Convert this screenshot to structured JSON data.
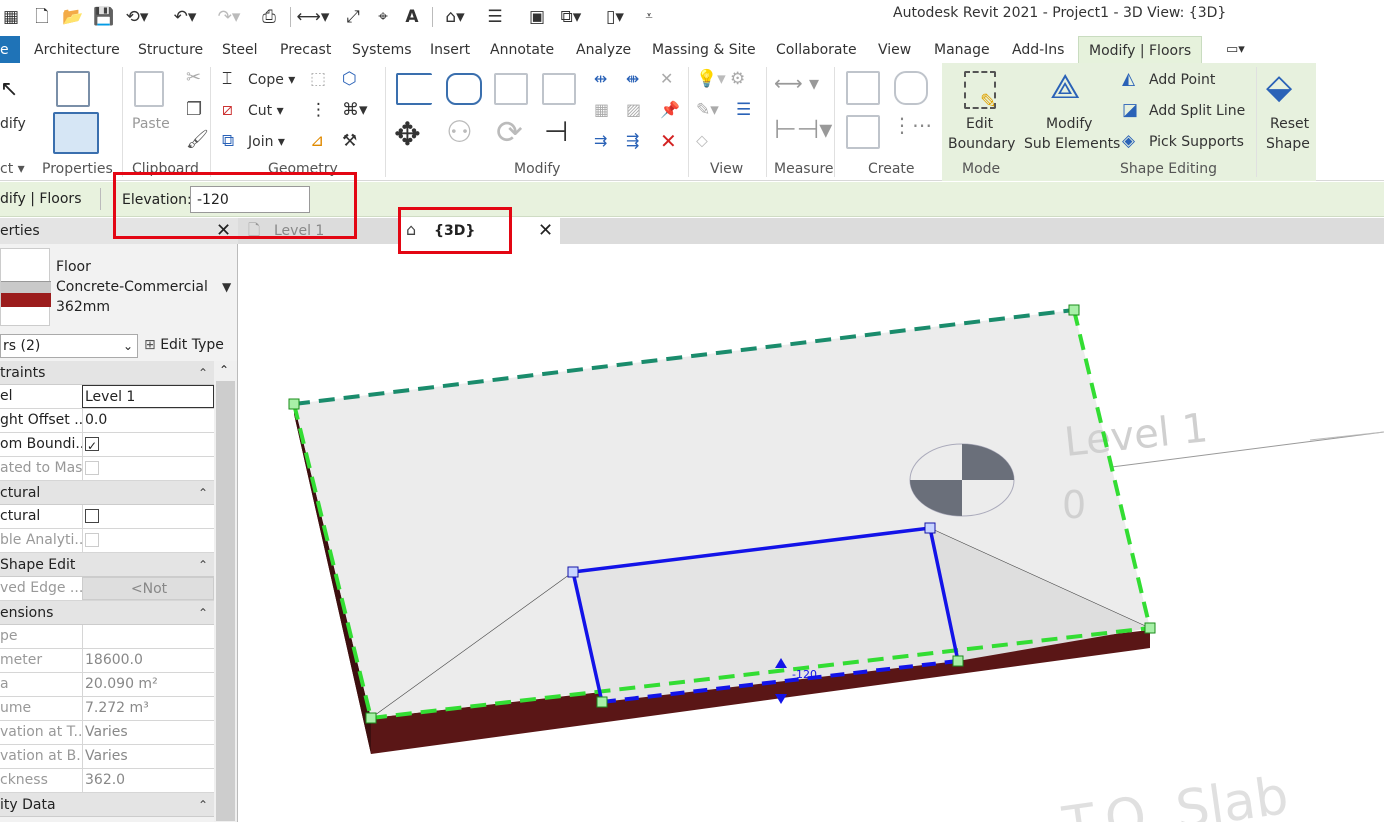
{
  "app_title": "Autodesk Revit 2021 - Project1 - 3D View: {3D}",
  "tabs": [
    {
      "label": "Architecture"
    },
    {
      "label": "Structure"
    },
    {
      "label": "Steel"
    },
    {
      "label": "Precast"
    },
    {
      "label": "Systems"
    },
    {
      "label": "Insert"
    },
    {
      "label": "Annotate"
    },
    {
      "label": "Analyze"
    },
    {
      "label": "Massing & Site"
    },
    {
      "label": "Collaborate"
    },
    {
      "label": "View"
    },
    {
      "label": "Manage"
    },
    {
      "label": "Add-Ins"
    },
    {
      "label": "Modify | Floors"
    }
  ],
  "ribbon": {
    "modify_label": "dify",
    "select_label": "ct",
    "properties_label": "Properties",
    "paste_label": "Paste",
    "cope_label": "Cope",
    "cut_label": "Cut",
    "join_label": "Join",
    "edit_boundary_label": "Edit Boundary",
    "edit_boundary_l1": "Edit",
    "edit_boundary_l2": "Boundary",
    "modify_sub_l1": "Modify",
    "modify_sub_l2": "Sub Elements",
    "add_point_label": "Add Point",
    "add_split_line_label": "Add Split Line",
    "pick_supports_label": "Pick Supports",
    "reset_shape_l1": "Reset",
    "reset_shape_l2": "Shape",
    "panels": {
      "clipboard": "Clipboard",
      "geometry": "Geometry",
      "modify": "Modify",
      "view": "View",
      "measure": "Measure",
      "create": "Create",
      "mode": "Mode",
      "shape_editing": "Shape Editing"
    }
  },
  "options_bar": {
    "context": "dify | Floors",
    "elevation_label": "Elevation:",
    "elevation_value": "-120"
  },
  "view_tabs": {
    "properties_title": "erties",
    "level1": "Level 1",
    "view3d": "{3D}"
  },
  "properties": {
    "type_family": "Floor",
    "type_name": "Concrete-Commercial",
    "type_thickness": "362mm",
    "selector": "rs (2)",
    "edit_type": "Edit Type",
    "groups": [
      {
        "name": "traints",
        "rows": [
          {
            "key": "el",
            "value": "Level 1",
            "kind": "input"
          },
          {
            "key": "ght Offset ...",
            "value": "0.0",
            "kind": "text"
          },
          {
            "key": "om Boundi...",
            "value": "",
            "kind": "check",
            "checked": true
          },
          {
            "key": "ated to Mass",
            "value": "",
            "kind": "check-dis",
            "checked": false,
            "disabled": true
          }
        ]
      },
      {
        "name": "ctural",
        "rows": [
          {
            "key": "ctural",
            "value": "",
            "kind": "check",
            "checked": false
          },
          {
            "key": "ble Analyti...",
            "value": "",
            "kind": "check-dis",
            "checked": false,
            "disabled": true
          }
        ]
      },
      {
        "name": " Shape Edit",
        "rows": [
          {
            "key": "ved Edge ...",
            "value": "<Not",
            "kind": "button",
            "disabled": true
          }
        ]
      },
      {
        "name": "ensions",
        "rows": [
          {
            "key": "pe",
            "value": "",
            "kind": "text",
            "disabled": true
          },
          {
            "key": "meter",
            "value": "18600.0",
            "kind": "text",
            "disabled": true
          },
          {
            "key": "a",
            "value": "20.090 m²",
            "kind": "text",
            "disabled": true
          },
          {
            "key": "ume",
            "value": "7.272 m³",
            "kind": "text",
            "disabled": true
          },
          {
            "key": "vation at T...",
            "value": "Varies",
            "kind": "text",
            "disabled": true
          },
          {
            "key": "vation at B...",
            "value": "Varies",
            "kind": "text",
            "disabled": true
          },
          {
            "key": "ckness",
            "value": "362.0",
            "kind": "text",
            "disabled": true
          }
        ]
      },
      {
        "name": "ity Data",
        "rows": []
      }
    ]
  },
  "viewport": {
    "level_label": "Level 1",
    "level_value": "0",
    "dim_value": "-120",
    "bg_text": "T.O. Slab"
  },
  "colors": {
    "accent": "#1f73b7",
    "highlight": "#e30613",
    "context_green": "#e7f1de",
    "floor_edge": "#5a1616",
    "boundary_green": "#33dd33",
    "subelement_blue": "#1313e8"
  }
}
